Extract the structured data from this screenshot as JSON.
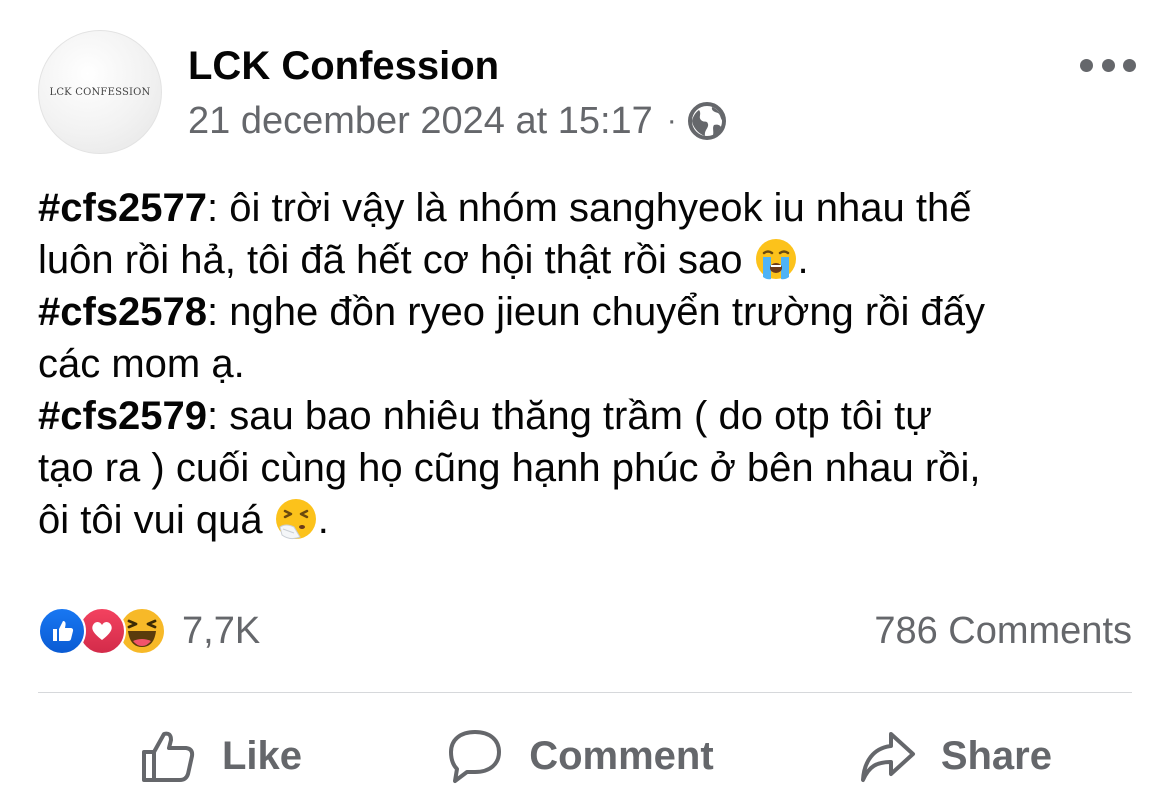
{
  "header": {
    "avatar_text": "LCK CONFESSION",
    "page_name": "LCK Confession",
    "timestamp": "21 december 2024 at 15:17",
    "separator": "·",
    "audience_icon": "globe-icon",
    "more_icon": "more-options-icon"
  },
  "post": {
    "lines": [
      {
        "tag": "#cfs2577",
        "text": ": ôi trời vậy là nhóm sanghyeok iu nhau thế"
      },
      {
        "tag": "",
        "text": "luôn rồi hả, tôi đã hết cơ hội thật rồi sao ",
        "emoji": "loudly-crying-face-emoji",
        "after": "."
      },
      {
        "tag": "#cfs2578",
        "text": ": nghe đồn ryeo jieun chuyển trường rồi đấy"
      },
      {
        "tag": "",
        "text": "các mom ạ."
      },
      {
        "tag": "#cfs2579",
        "text": ": sau bao nhiêu thăng trầm ( do otp tôi tự"
      },
      {
        "tag": "",
        "text": "tạo ra ) cuối cùng họ cũng hạnh phúc ở bên nhau rồi,"
      },
      {
        "tag": "",
        "text": "ôi tôi vui quá ",
        "emoji": "sneezing-face-emoji",
        "after": "."
      }
    ]
  },
  "reactions": {
    "icons": [
      "like-reaction-icon",
      "love-reaction-icon",
      "haha-reaction-icon"
    ],
    "count": "7,7K"
  },
  "comments": {
    "label": "786 Comments"
  },
  "actions": {
    "like_label": "Like",
    "comment_label": "Comment",
    "share_label": "Share"
  },
  "colors": {
    "text_primary": "#050505",
    "text_secondary": "#65676b",
    "like_blue": "#1877f2",
    "love_red": "#f3425f",
    "haha_yellow": "#f7b928",
    "divider": "#d6d8db"
  }
}
